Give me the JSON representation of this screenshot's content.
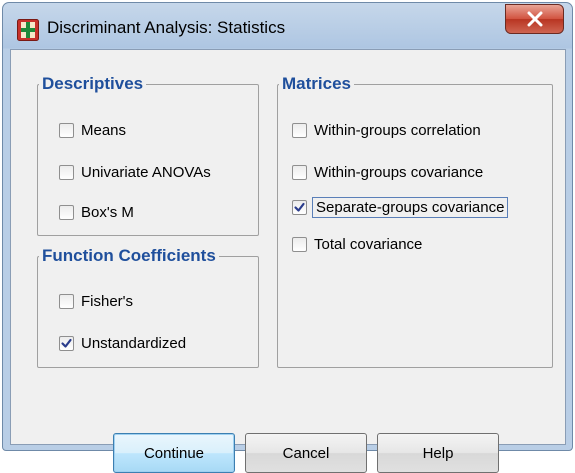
{
  "window": {
    "title": "Discriminant Analysis: Statistics"
  },
  "descriptives": {
    "legend": "Descriptives",
    "items": [
      {
        "label": "Means",
        "checked": false
      },
      {
        "label": "Univariate ANOVAs",
        "checked": false
      },
      {
        "label": "Box's M",
        "checked": false
      }
    ]
  },
  "function_coefficients": {
    "legend": "Function Coefficients",
    "items": [
      {
        "label": "Fisher's",
        "checked": false
      },
      {
        "label": "Unstandardized",
        "checked": true
      }
    ]
  },
  "matrices": {
    "legend": "Matrices",
    "items": [
      {
        "label": "Within-groups correlation",
        "checked": false
      },
      {
        "label": "Within-groups covariance",
        "checked": false
      },
      {
        "label": "Separate-groups covariance",
        "checked": true
      },
      {
        "label": "Total covariance",
        "checked": false
      }
    ]
  },
  "buttons": {
    "continue": "Continue",
    "cancel": "Cancel",
    "help": "Help"
  },
  "icons": {
    "app": "spss-dialog-icon",
    "close": "close-icon",
    "check": "checkmark-icon"
  },
  "colors": {
    "legend_text": "#1f4f9c",
    "close_button": "#c9402c",
    "focus_outline": "#5a7fb8"
  }
}
